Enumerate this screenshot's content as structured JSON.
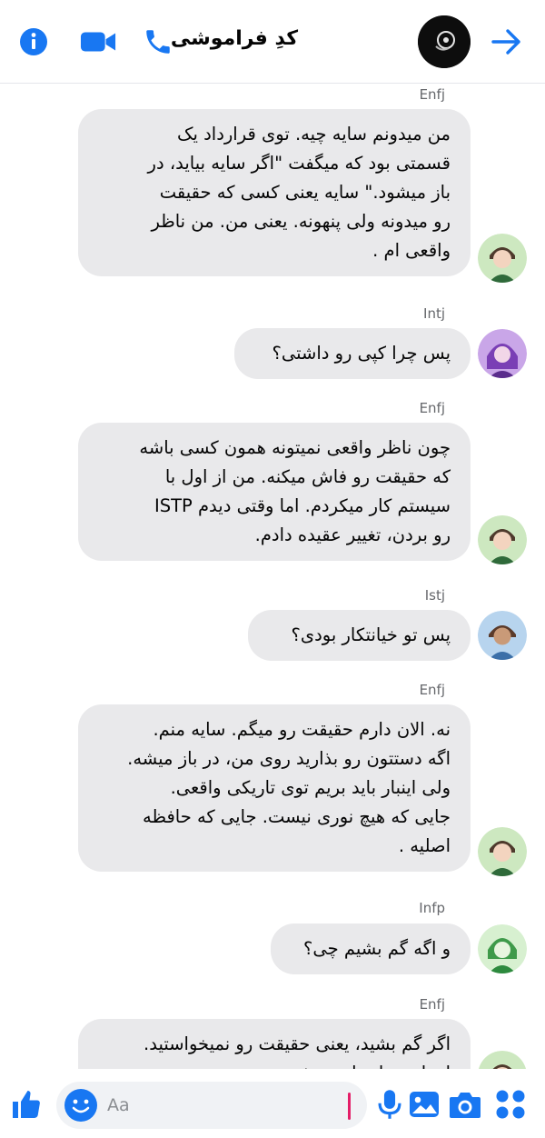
{
  "header": {
    "title": "کدِ فراموشی",
    "icons": {
      "info": "info-icon",
      "video": "video-call-icon",
      "phone": "phone-call-icon",
      "back": "arrow-right-icon"
    },
    "accent": "#1877f2"
  },
  "messages": [
    {
      "sender": "Enfj",
      "lines": [
        "من میدونم سایه چیه. توی قرارداد یک",
        "قسمتی بود که میگفت \"اگر سایه بیاید، در",
        "باز میشود.\" سایه یعنی کسی که حقیقت",
        "رو میدونه ولی پنهونه. یعنی من. من ناظر",
        "واقعی ام ."
      ]
    },
    {
      "sender": "Intj",
      "lines": [
        "پس چرا کپی رو داشتی؟"
      ]
    },
    {
      "sender": "Enfj",
      "lines": [
        "چون ناظر واقعی نمیتونه همون کسی باشه",
        "که حقیقت رو فاش میکنه. من از اول با",
        "سیستم کار میکردم. اما وقتی دیدم ISTP",
        "رو بردن، تغییر عقیده دادم."
      ]
    },
    {
      "sender": "Istj",
      "lines": [
        "پس تو خیانتکار بودی؟"
      ]
    },
    {
      "sender": "Enfj",
      "lines": [
        "نه. الان دارم حقیقت رو میگم. سایه منم.",
        "اگه دستتون رو بذارید روی من، در باز میشه.",
        "ولی اینبار باید بریم توی تاریکی واقعی.",
        "جایی که هیچ نوری نیست. جایی که حافظه",
        "اصلیه ."
      ]
    },
    {
      "sender": "Infp",
      "lines": [
        "و اگه گم بشیم چی؟"
      ]
    },
    {
      "sender": "Enfj",
      "lines": [
        "اگر گم بشید، یعنی حقیقت رو نمیخواستید.",
        "اینطوری انتخاب میشه"
      ]
    }
  ],
  "composer": {
    "placeholder": "Aa",
    "icons": [
      "like-icon",
      "emoji-icon",
      "microphone-icon",
      "gallery-icon",
      "camera-icon",
      "apps-grid-icon"
    ],
    "cursor_color": "#e41e68"
  }
}
